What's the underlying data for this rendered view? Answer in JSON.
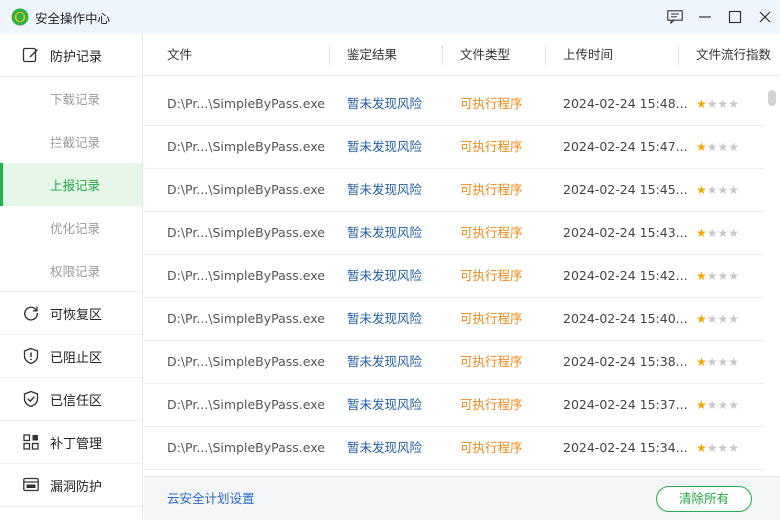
{
  "window": {
    "title": "安全操作中心",
    "controls": [
      "feedback-icon",
      "minimize-icon",
      "maximize-icon",
      "close-icon"
    ]
  },
  "sidebar": {
    "items": [
      {
        "label": "防护记录",
        "icon": "edit-note-icon"
      },
      {
        "label": "下载记录",
        "sub": true
      },
      {
        "label": "拦截记录",
        "sub": true
      },
      {
        "label": "上报记录",
        "sub": true,
        "active": true
      },
      {
        "label": "优化记录",
        "sub": true
      },
      {
        "label": "权限记录",
        "sub": true
      },
      {
        "label": "可恢复区",
        "icon": "restore-icon"
      },
      {
        "label": "已阻止区",
        "icon": "shield-alert-icon"
      },
      {
        "label": "已信任区",
        "icon": "shield-check-icon"
      },
      {
        "label": "补丁管理",
        "icon": "grid-icon"
      },
      {
        "label": "漏洞防护",
        "icon": "vulnerability-icon"
      }
    ]
  },
  "table": {
    "headers": [
      "文件",
      "鉴定结果",
      "文件类型",
      "上传时间",
      "文件流行指数"
    ],
    "rows": [
      {
        "file": "D:\\Pr...\\SimpleByPass.exe",
        "result": "暂未发现风险",
        "type": "可执行程序",
        "time": "2024-02-24 15:48...",
        "rating": 1
      },
      {
        "file": "D:\\Pr...\\SimpleByPass.exe",
        "result": "暂未发现风险",
        "type": "可执行程序",
        "time": "2024-02-24 15:47...",
        "rating": 1
      },
      {
        "file": "D:\\Pr...\\SimpleByPass.exe",
        "result": "暂未发现风险",
        "type": "可执行程序",
        "time": "2024-02-24 15:45...",
        "rating": 1
      },
      {
        "file": "D:\\Pr...\\SimpleByPass.exe",
        "result": "暂未发现风险",
        "type": "可执行程序",
        "time": "2024-02-24 15:43...",
        "rating": 1
      },
      {
        "file": "D:\\Pr...\\SimpleByPass.exe",
        "result": "暂未发现风险",
        "type": "可执行程序",
        "time": "2024-02-24 15:42...",
        "rating": 1
      },
      {
        "file": "D:\\Pr...\\SimpleByPass.exe",
        "result": "暂未发现风险",
        "type": "可执行程序",
        "time": "2024-02-24 15:40...",
        "rating": 1
      },
      {
        "file": "D:\\Pr...\\SimpleByPass.exe",
        "result": "暂未发现风险",
        "type": "可执行程序",
        "time": "2024-02-24 15:38...",
        "rating": 1
      },
      {
        "file": "D:\\Pr...\\SimpleByPass.exe",
        "result": "暂未发现风险",
        "type": "可执行程序",
        "time": "2024-02-24 15:37...",
        "rating": 1
      },
      {
        "file": "D:\\Pr...\\SimpleByPass.exe",
        "result": "暂未发现风险",
        "type": "可执行程序",
        "time": "2024-02-24 15:34...",
        "rating": 1
      }
    ],
    "max_rating": 4
  },
  "scrollbar": {
    "position": 0.0,
    "visible_fraction": 0.04
  },
  "footer": {
    "link_label": "云安全计划设置",
    "button_label": "清除所有"
  },
  "colors": {
    "accent_green": "#22b14c",
    "result_blue": "#1f5fa8",
    "type_orange": "#f08a18",
    "star": "#f0a800",
    "titlebar_bg": "#eef5fc"
  }
}
